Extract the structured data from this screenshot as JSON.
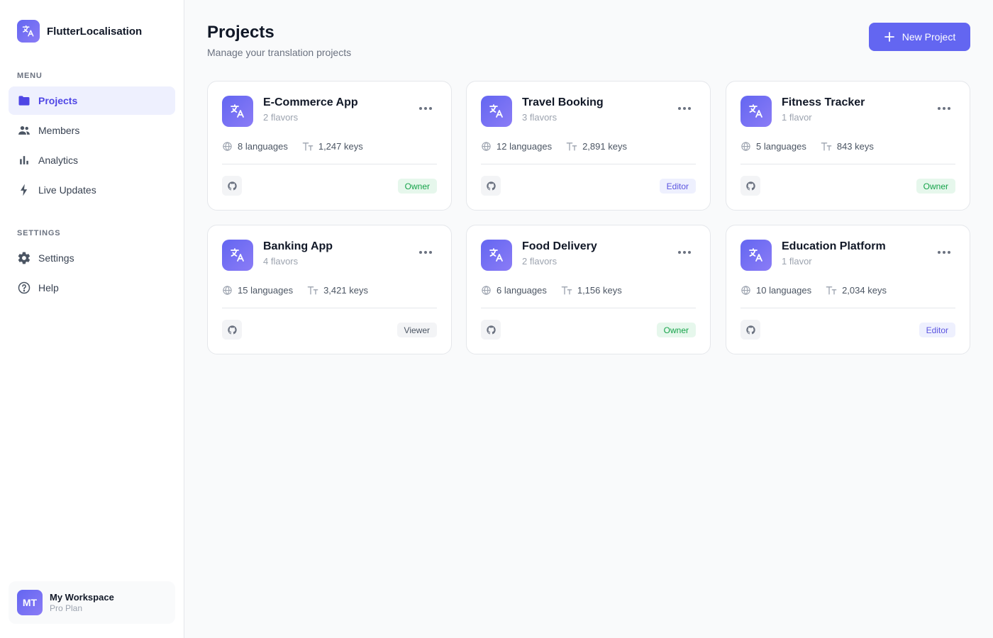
{
  "brand": {
    "name": "FlutterLocalisation",
    "icon": "translate-icon"
  },
  "sidebar": {
    "menu_label": "MENU",
    "menu_items": [
      {
        "label": "Projects",
        "icon": "folder-icon",
        "active": true
      },
      {
        "label": "Members",
        "icon": "people-icon",
        "active": false
      },
      {
        "label": "Analytics",
        "icon": "bar-chart-icon",
        "active": false
      },
      {
        "label": "Live Updates",
        "icon": "bolt-icon",
        "active": false
      }
    ],
    "settings_label": "SETTINGS",
    "settings_items": [
      {
        "label": "Settings",
        "icon": "gear-icon"
      },
      {
        "label": "Help",
        "icon": "help-circle-icon"
      }
    ],
    "workspace": {
      "initials": "MT",
      "name": "My Workspace",
      "plan": "Pro Plan"
    }
  },
  "header": {
    "title": "Projects",
    "subtitle": "Manage your translation projects",
    "new_button": "New Project"
  },
  "projects": [
    {
      "name": "E-Commerce App",
      "flavors": "2 flavors",
      "languages": "8 languages",
      "keys": "1,247 keys",
      "role": "Owner"
    },
    {
      "name": "Travel Booking",
      "flavors": "3 flavors",
      "languages": "12 languages",
      "keys": "2,891 keys",
      "role": "Editor"
    },
    {
      "name": "Fitness Tracker",
      "flavors": "1 flavor",
      "languages": "5 languages",
      "keys": "843 keys",
      "role": "Owner"
    },
    {
      "name": "Banking App",
      "flavors": "4 flavors",
      "languages": "15 languages",
      "keys": "3,421 keys",
      "role": "Viewer"
    },
    {
      "name": "Food Delivery",
      "flavors": "2 flavors",
      "languages": "6 languages",
      "keys": "1,156 keys",
      "role": "Owner"
    },
    {
      "name": "Education Platform",
      "flavors": "1 flavor",
      "languages": "10 languages",
      "keys": "2,034 keys",
      "role": "Editor"
    }
  ],
  "colors": {
    "accent": "#6366f1",
    "owner_badge": "#16a34a",
    "editor_badge": "#5b54e0",
    "viewer_badge": "#4b5563"
  }
}
